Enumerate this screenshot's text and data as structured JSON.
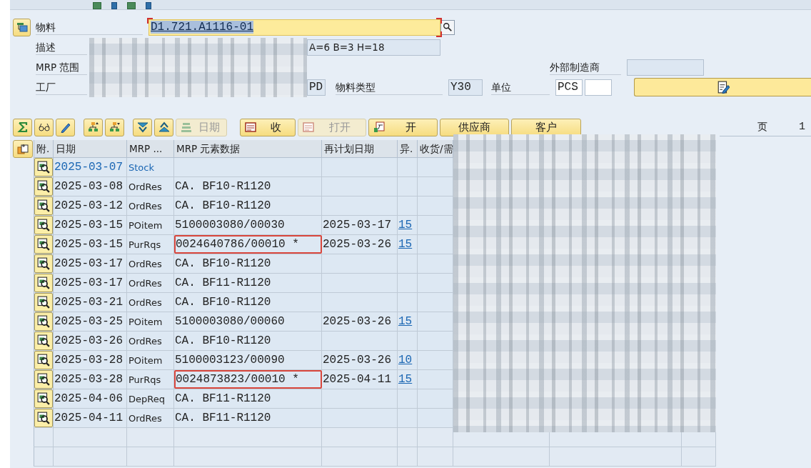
{
  "material_header": {
    "material_label": "物料",
    "material_value": "D1.721.A1116-01",
    "description_label": "描述",
    "description_value": "A=6 B=3 H=18",
    "mrp_area_label": "MRP 范围",
    "external_manufacturer_label": "外部制造商",
    "plant_label": "工厂",
    "mrp_type_value": "PD",
    "material_type_label": "物料类型",
    "material_type_value": "Y30",
    "unit_label": "单位",
    "unit_value": "PCS"
  },
  "toolbar_text_buttons": [
    {
      "label": "日期",
      "disabled": true
    },
    {
      "label": "收",
      "disabled": false
    },
    {
      "label": "打开",
      "disabled": true
    },
    {
      "label": "开",
      "disabled": false
    },
    {
      "label": "供应商",
      "disabled": false
    },
    {
      "label": "客户",
      "disabled": false
    }
  ],
  "page": {
    "label": "页",
    "value": "1"
  },
  "table": {
    "columns": [
      "附.",
      "日期",
      "MRP ...",
      "MRP 元素数据",
      "再计划日期",
      "异.",
      "收货/需"
    ],
    "rows": [
      {
        "kind": "stock",
        "date": "2025-03-07",
        "mrp_element": "Stock",
        "highlighted": false
      },
      {
        "kind": "element",
        "date": "2025-03-08",
        "mrp_element": "OrdRes",
        "element_data": "CA. BF10-R1120",
        "highlighted": false
      },
      {
        "kind": "element",
        "date": "2025-03-12",
        "mrp_element": "OrdRes",
        "element_data": "CA. BF10-R1120",
        "highlighted": false
      },
      {
        "kind": "element",
        "date": "2025-03-15",
        "mrp_element": "POitem",
        "element_data": "5100003080/00030",
        "reschedule_date": "2025-03-17",
        "exception": "15",
        "highlighted": false
      },
      {
        "kind": "element",
        "date": "2025-03-15",
        "mrp_element": "PurRqs",
        "element_data": "0024640786/00010 *",
        "reschedule_date": "2025-03-26",
        "exception": "15",
        "highlighted": true
      },
      {
        "kind": "element",
        "date": "2025-03-17",
        "mrp_element": "OrdRes",
        "element_data": "CA. BF10-R1120",
        "highlighted": false
      },
      {
        "kind": "element",
        "date": "2025-03-17",
        "mrp_element": "OrdRes",
        "element_data": "CA. BF11-R1120",
        "highlighted": false
      },
      {
        "kind": "element",
        "date": "2025-03-21",
        "mrp_element": "OrdRes",
        "element_data": "CA. BF10-R1120",
        "highlighted": false
      },
      {
        "kind": "element",
        "date": "2025-03-25",
        "mrp_element": "POitem",
        "element_data": "5100003080/00060",
        "reschedule_date": "2025-03-26",
        "exception": "15",
        "highlighted": false
      },
      {
        "kind": "element",
        "date": "2025-03-26",
        "mrp_element": "OrdRes",
        "element_data": "CA. BF10-R1120",
        "highlighted": false
      },
      {
        "kind": "element",
        "date": "2025-03-28",
        "mrp_element": "POitem",
        "element_data": "5100003123/00090",
        "reschedule_date": "2025-03-26",
        "exception": "10",
        "highlighted": false
      },
      {
        "kind": "element",
        "date": "2025-03-28",
        "mrp_element": "PurRqs",
        "element_data": "0024873823/00010 *",
        "reschedule_date": "2025-04-11",
        "exception": "15",
        "highlighted": true
      },
      {
        "kind": "element",
        "date": "2025-04-06",
        "mrp_element": "DepReq",
        "element_data": "CA. BF11-R1120",
        "highlighted": false
      },
      {
        "kind": "element",
        "date": "2025-04-11",
        "mrp_element": "OrdRes",
        "element_data": "CA. BF11-R1120",
        "highlighted": false
      }
    ]
  }
}
